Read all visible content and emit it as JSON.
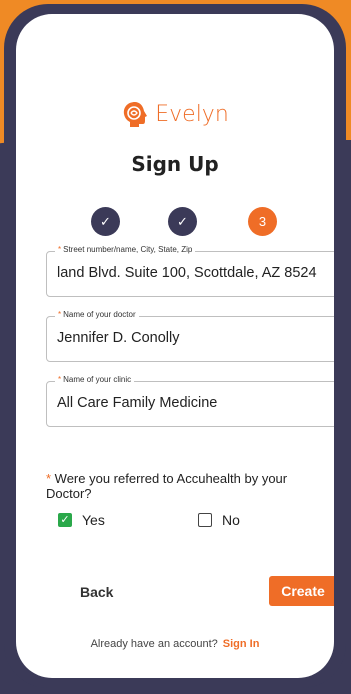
{
  "brand": {
    "name": "Evelyn",
    "color": "#ef6d27",
    "icon": "head-logo-icon"
  },
  "title": "Sign Up",
  "steps": [
    {
      "state": "done",
      "label": "✓"
    },
    {
      "state": "done",
      "label": "✓"
    },
    {
      "state": "active",
      "label": "3"
    }
  ],
  "fields": [
    {
      "label": "Street number/name, City, State, Zip",
      "value": "land Blvd. Suite 100, Scottdale, AZ 8524"
    },
    {
      "label": "Name of your doctor",
      "value": "Jennifer D. Conolly"
    },
    {
      "label": "Name of your clinic",
      "value": "All Care Family Medicine"
    }
  ],
  "question": {
    "text": "Were you referred to Accuhealth by your Doctor?",
    "options": [
      {
        "label": "Yes",
        "checked": true
      },
      {
        "label": "No",
        "checked": false
      }
    ]
  },
  "actions": {
    "back": "Back",
    "create": "Create"
  },
  "footer": {
    "prompt": "Already have an account?",
    "link": "Sign In"
  }
}
